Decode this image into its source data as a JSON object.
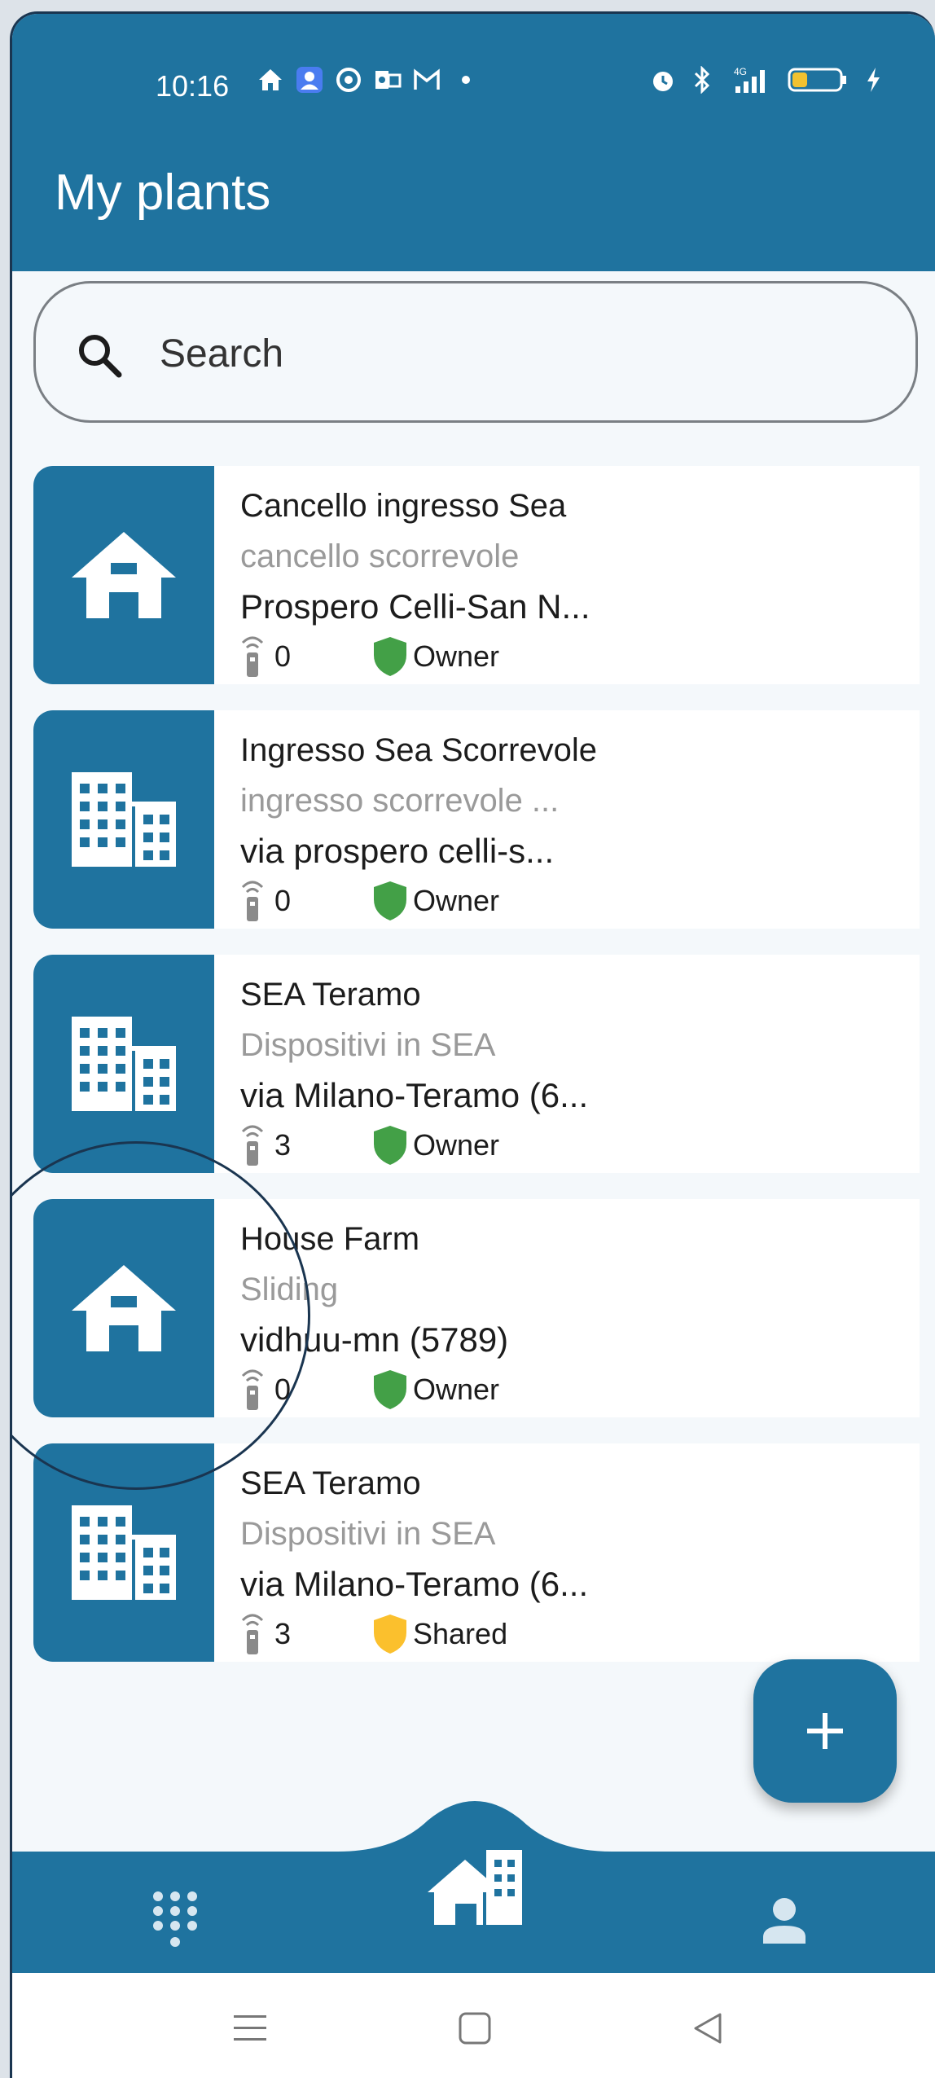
{
  "status_bar": {
    "time": "10:16",
    "left_icons": [
      "home-status-icon",
      "account-status-icon",
      "chrome-status-icon",
      "outlook-status-icon",
      "gmail-status-icon",
      "dot-status-icon"
    ],
    "right_icons": [
      "alarm-status-icon",
      "bluetooth-status-icon",
      "signal-4g-status-icon",
      "battery-status-icon",
      "charging-status-icon"
    ],
    "network_label": "4G"
  },
  "app_bar": {
    "title": "My plants"
  },
  "search": {
    "placeholder": "Search",
    "value": ""
  },
  "plants": [
    {
      "name": "Cancello ingresso Sea",
      "description": "cancello scorrevole",
      "address": "Prospero Celli-San N...",
      "devices": "0",
      "role": "Owner",
      "role_color": "#43a047",
      "icon": "house-icon"
    },
    {
      "name": "Ingresso Sea Scorrevole",
      "description": "ingresso scorrevole ...",
      "address": "via prospero celli-s...",
      "devices": "0",
      "role": "Owner",
      "role_color": "#43a047",
      "icon": "building-icon"
    },
    {
      "name": "SEA Teramo",
      "description": "Dispositivi in SEA",
      "address": "via Milano-Teramo (6...",
      "devices": "3",
      "role": "Owner",
      "role_color": "#43a047",
      "icon": "building-icon"
    },
    {
      "name": "House Farm",
      "description": "Sliding",
      "address": "vidhuu-mn (5789)",
      "devices": "0",
      "role": "Owner",
      "role_color": "#43a047",
      "icon": "house-icon"
    },
    {
      "name": "SEA Teramo",
      "description": "Dispositivi in SEA",
      "address": "via Milano-Teramo (6...",
      "devices": "3",
      "role": "Shared",
      "role_color": "#fbc02d",
      "icon": "building-icon"
    }
  ],
  "fab": {
    "icon": "plus-icon"
  },
  "bottom_nav": {
    "items": [
      {
        "icon": "keypad-icon"
      },
      {
        "icon": "plants-home-icon",
        "active": true
      },
      {
        "icon": "profile-icon"
      }
    ]
  },
  "system_nav": {
    "buttons": [
      "menu-icon",
      "home-square-icon",
      "back-triangle-icon"
    ]
  },
  "colors": {
    "primary": "#1f739f",
    "background": "#f4f8fb",
    "owner": "#43a047",
    "shared": "#fbc02d"
  }
}
